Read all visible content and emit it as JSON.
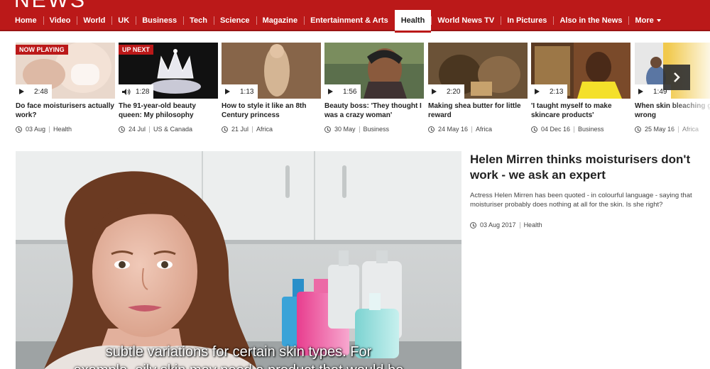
{
  "brand": {
    "name": "NEWS"
  },
  "nav": {
    "items": [
      {
        "label": "Home"
      },
      {
        "label": "Video"
      },
      {
        "label": "World"
      },
      {
        "label": "UK"
      },
      {
        "label": "Business"
      },
      {
        "label": "Tech"
      },
      {
        "label": "Science"
      },
      {
        "label": "Magazine"
      },
      {
        "label": "Entertainment & Arts"
      },
      {
        "label": "Health"
      },
      {
        "label": "World News TV"
      },
      {
        "label": "In Pictures"
      },
      {
        "label": "Also in the News"
      },
      {
        "label": "More"
      }
    ],
    "active": "Health"
  },
  "carousel": {
    "cards": [
      {
        "badge": "NOW PLAYING",
        "duration": "2:48",
        "title": "Do face moisturisers actually work?",
        "date": "03 Aug",
        "section": "Health"
      },
      {
        "badge": "UP NEXT",
        "duration": "1:28",
        "title": "The 91-year-old beauty queen: My philosophy",
        "date": "24 Jul",
        "section": "US & Canada"
      },
      {
        "badge": "",
        "duration": "1:13",
        "title": "How to style it like an 8th Century princess",
        "date": "21 Jul",
        "section": "Africa"
      },
      {
        "badge": "",
        "duration": "1:56",
        "title": "Beauty boss: 'They thought I was a crazy woman'",
        "date": "30 May",
        "section": "Business"
      },
      {
        "badge": "",
        "duration": "2:20",
        "title": "Making shea butter for little reward",
        "date": "24 May 16",
        "section": "Africa"
      },
      {
        "badge": "",
        "duration": "2:13",
        "title": "'I taught myself to make skincare products'",
        "date": "04 Dec 16",
        "section": "Business"
      },
      {
        "badge": "",
        "duration": "1:49",
        "title": "When skin bleaching goes wrong",
        "date": "25 May 16",
        "section": "Africa"
      }
    ]
  },
  "video": {
    "subtitle_line1": "subtle variations for certain skin types. For",
    "subtitle_line2": "example, oily skin may need a product that would be"
  },
  "story": {
    "headline": "Helen Mirren thinks moisturisers don't work - we ask an expert",
    "summary": "Actress Helen Mirren has been quoted - in colourful language - saying that moisturiser probably does nothing at all for the skin. Is she right?",
    "date": "03 Aug 2017",
    "section": "Health"
  },
  "colors": {
    "brand_red": "#bb1919",
    "text": "#222222",
    "meta": "#444444"
  }
}
